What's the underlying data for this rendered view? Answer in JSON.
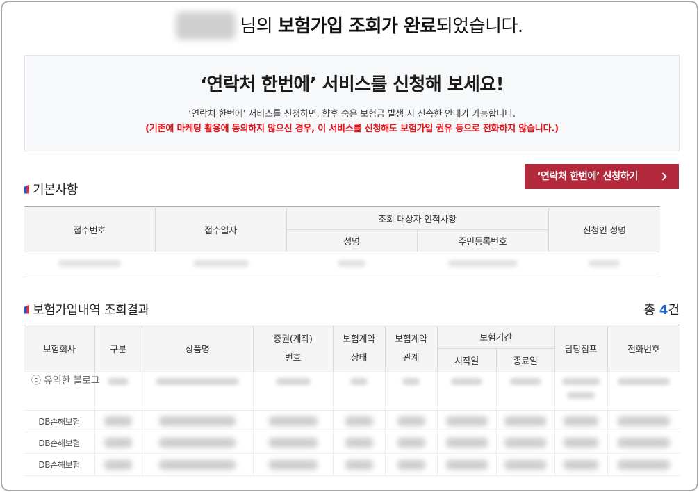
{
  "headline": {
    "prefix": "님의",
    "bold": "보험가입 조회가 완료",
    "suffix": "되었습니다."
  },
  "promo": {
    "title": "‘연락처 한번에’ 서비스를 신청해 보세요!",
    "description": "‘연락처 한번에’ 서비스를 신청하면, 향후 숨은 보험금 발생 시 신속한 안내가 가능합니다.",
    "notice": "(기존에 마케팅 활용에 동의하지 않으신 경우, 이 서비스를 신청해도 보험가입 권유 등으로 전화하지 않습니다.)",
    "button_label": "‘연락처 한번에’ 신청하기"
  },
  "basic_info": {
    "title": "기본사항",
    "columns": {
      "receipt_no": "접수번호",
      "receipt_date": "접수일자",
      "subject_group": "조회 대상자 인적사항",
      "subject_name": "성명",
      "subject_id": "주민등록번호",
      "applicant": "신청인 성명"
    }
  },
  "results": {
    "title": "보험가입내역 조회결과",
    "total": {
      "prefix": "총",
      "count": "4",
      "suffix": "건"
    },
    "columns": {
      "company": "보험회사",
      "category": "구분",
      "product": "상품명",
      "policy_no": [
        "증권(계좌)",
        "번호"
      ],
      "status": [
        "보험계약",
        "상태"
      ],
      "relation": [
        "보험계약",
        "관계"
      ],
      "period": "보험기간",
      "start_date": "시작일",
      "end_date": "종료일",
      "branch": "담당점포",
      "phone": "전화번호"
    },
    "rows": [
      {
        "company": null
      },
      {
        "company": "DB손해보험"
      },
      {
        "company": "DB손해보험"
      },
      {
        "company": "DB손해보험"
      }
    ]
  },
  "watermark": "ⓒ 유익한 블로그",
  "icons": {
    "section_marker": "section-flag-icon",
    "button_arrow": "chevron-right-icon"
  },
  "theme": {
    "button_bg": "#b4283c",
    "notice_text": "#e8141b",
    "count_text": "#1f63d1",
    "flag_blue": "#2456c8",
    "flag_red": "#e0313a"
  }
}
